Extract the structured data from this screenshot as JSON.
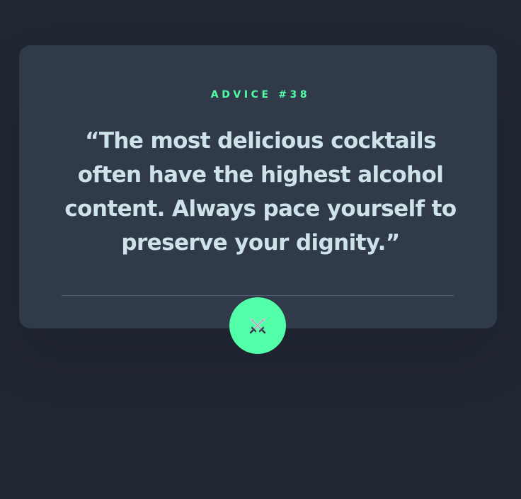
{
  "card": {
    "advice_id": "ADVICE #38",
    "advice_text": "“The most delicious cocktails often have the highest alcohol content. Always pace yourself to preserve your dignity.”"
  },
  "button": {
    "icon": "crossed-swords-icon",
    "accent_color": "#52ffa8"
  },
  "colors": {
    "background": "#202632",
    "card": "#313a49",
    "accent": "#52ffa8",
    "text": "#cee3e9",
    "divider": "#4f5d74"
  }
}
